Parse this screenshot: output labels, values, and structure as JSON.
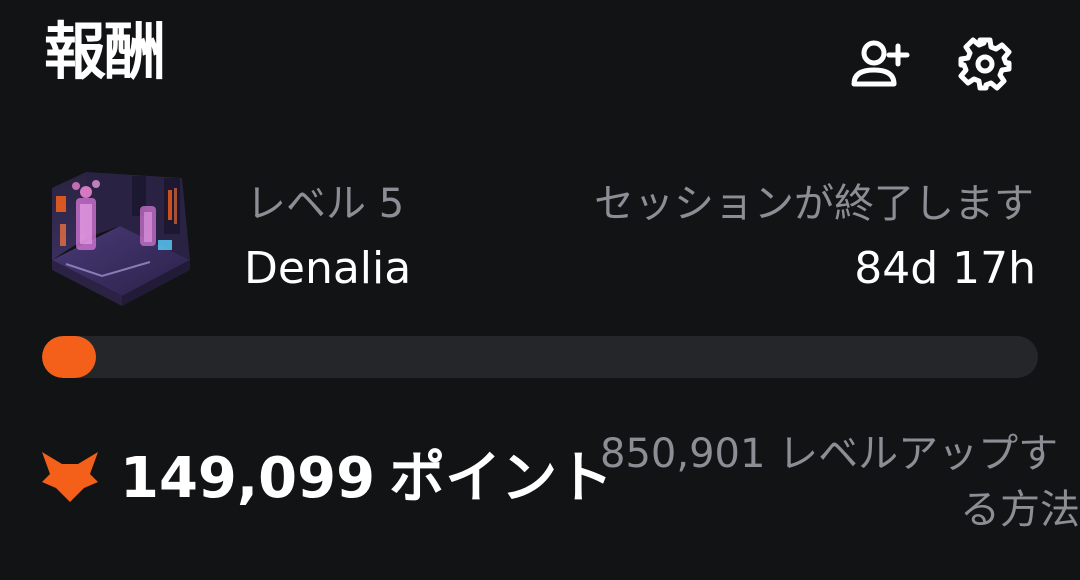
{
  "header": {
    "title": "報酬",
    "add_friend_icon": "add-user-icon",
    "settings_icon": "gear-icon"
  },
  "level": {
    "label": "レベル 5",
    "name": "Denalia",
    "art": "neon-room-illustration"
  },
  "session": {
    "label": "セッションが終了します",
    "time_remaining": "84d 17h"
  },
  "progress": {
    "fraction": 0.02,
    "color": "#f4601a"
  },
  "points": {
    "value": "149,099",
    "unit": "ポイント",
    "icon": "fox-icon",
    "color": "#f4601a"
  },
  "level_up": {
    "line1": "850,901 レベルアップす",
    "line2": "る方法"
  },
  "colors": {
    "background": "#121314",
    "muted_text": "#8b8e94",
    "track": "#25262a"
  }
}
